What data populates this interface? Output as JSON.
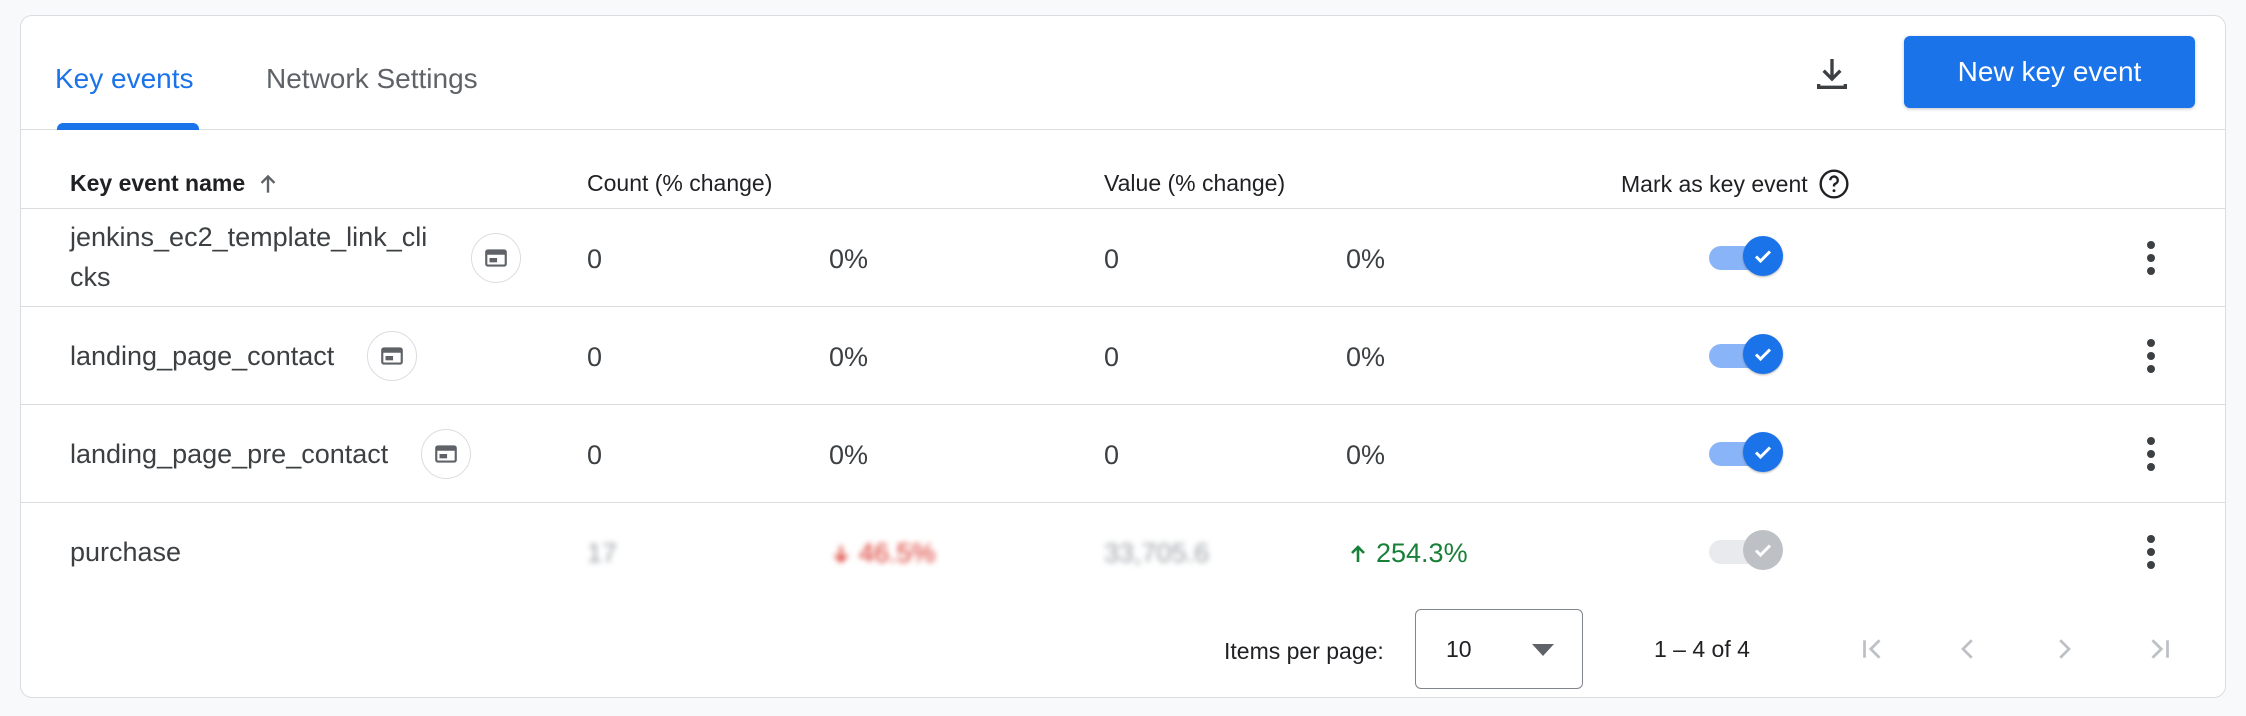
{
  "tabs": {
    "key_events": "Key events",
    "network_settings": "Network Settings"
  },
  "toolbar": {
    "download_icon": "download-icon",
    "new_key_event_label": "New key event"
  },
  "table": {
    "columns": {
      "name": "Key event name",
      "count": "Count (% change)",
      "value": "Value (% change)",
      "mark": "Mark as key event"
    },
    "rows": [
      {
        "name_line1": "jenkins_ec2_template_link_cli",
        "name_line2": "cks",
        "count": "0",
        "count_change": "0%",
        "value": "0",
        "value_change": "0%",
        "marked": true
      },
      {
        "name": "landing_page_contact",
        "count": "0",
        "count_change": "0%",
        "value": "0",
        "value_change": "0%",
        "marked": true
      },
      {
        "name": "landing_page_pre_contact",
        "count": "0",
        "count_change": "0%",
        "value": "0",
        "value_change": "0%",
        "marked": true
      },
      {
        "name": "purchase",
        "count": "17",
        "count_change": "46.5%",
        "value": "33,705.6",
        "value_change": "254.3%",
        "marked": true,
        "marked_disabled": true
      }
    ]
  },
  "pagination": {
    "items_per_page_label": "Items per page:",
    "items_per_page_value": "10",
    "range": "1 – 4 of 4"
  },
  "colors": {
    "accent": "#1a73e8",
    "positive": "#188038",
    "negative": "#d93025"
  }
}
